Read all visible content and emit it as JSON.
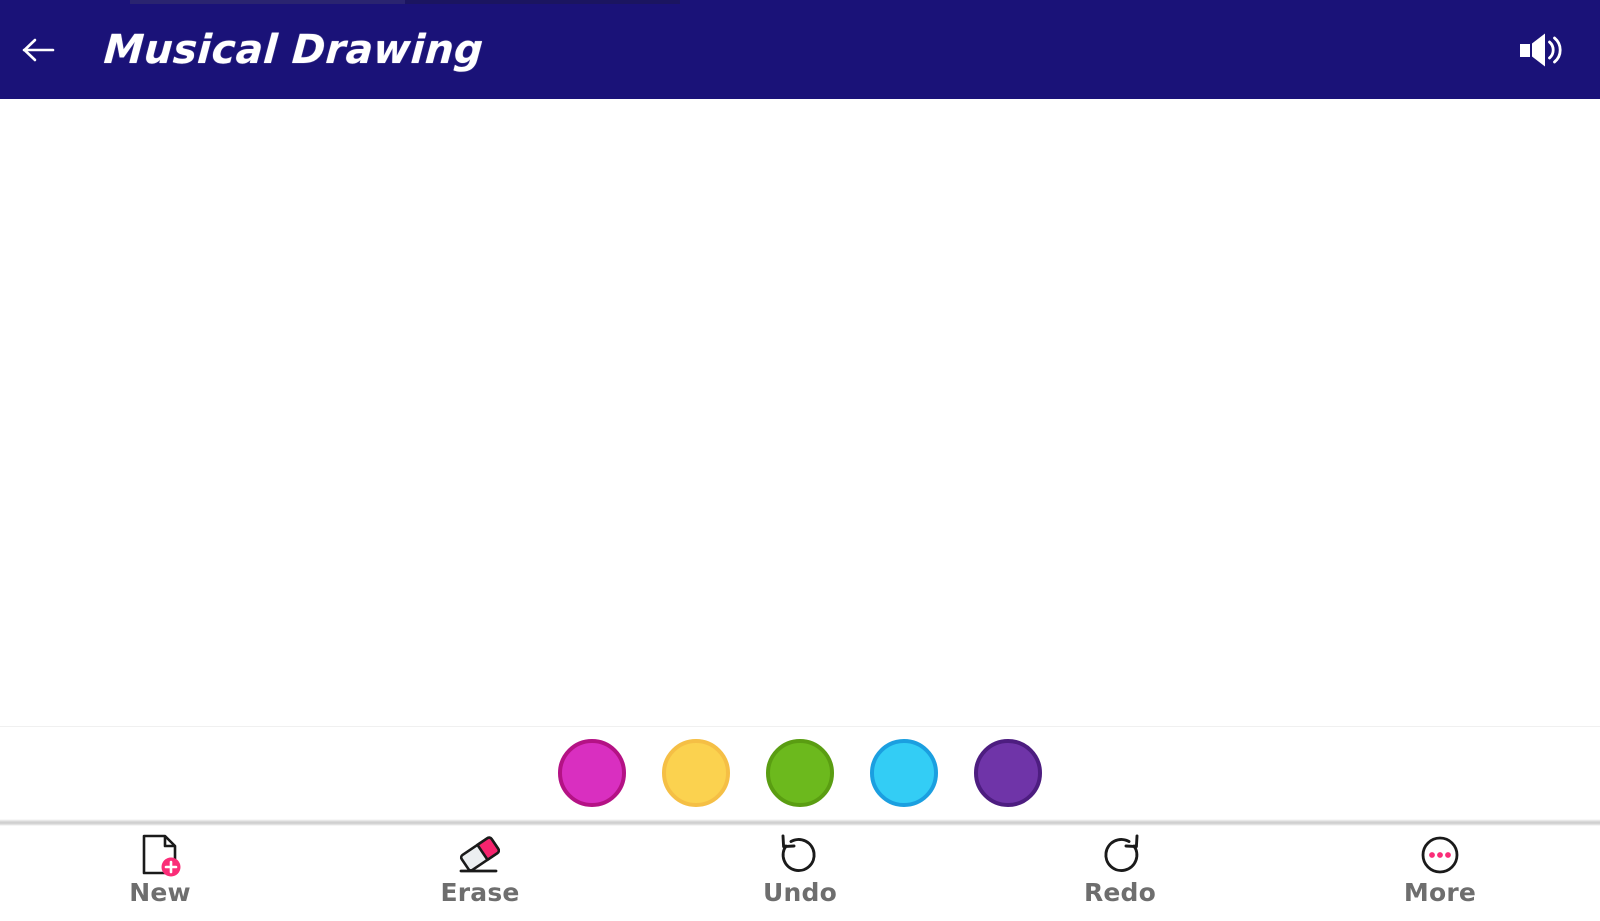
{
  "app": {
    "title": "Musical Drawing",
    "header_bg": "#1a1278",
    "canvas_bg": "#ffffff"
  },
  "header": {
    "back_icon": "arrow-left-icon",
    "back_label": "Back",
    "volume_icon": "volume-up-icon",
    "volume_label": "Sound"
  },
  "palette": {
    "label": "Color palette",
    "colors": [
      {
        "name": "magenta",
        "fill": "#d92fc0",
        "border": "#b41285"
      },
      {
        "name": "yellow",
        "fill": "#fbd24f",
        "border": "#f5bf45"
      },
      {
        "name": "green",
        "fill": "#6cb91d",
        "border": "#5a9d12"
      },
      {
        "name": "cyan",
        "fill": "#33cdf5",
        "border": "#1b9fe0"
      },
      {
        "name": "purple",
        "fill": "#6f34a8",
        "border": "#4d1d80"
      }
    ]
  },
  "toolbar": {
    "items": [
      {
        "label": "New",
        "icon": "new-document-icon"
      },
      {
        "label": "Erase",
        "icon": "eraser-icon"
      },
      {
        "label": "Undo",
        "icon": "undo-arrow-icon"
      },
      {
        "label": "Redo",
        "icon": "redo-arrow-icon"
      },
      {
        "label": "More",
        "icon": "more-dots-icon"
      }
    ],
    "accent_color": "#fa2d78",
    "label_color": "#6e6e6e"
  }
}
